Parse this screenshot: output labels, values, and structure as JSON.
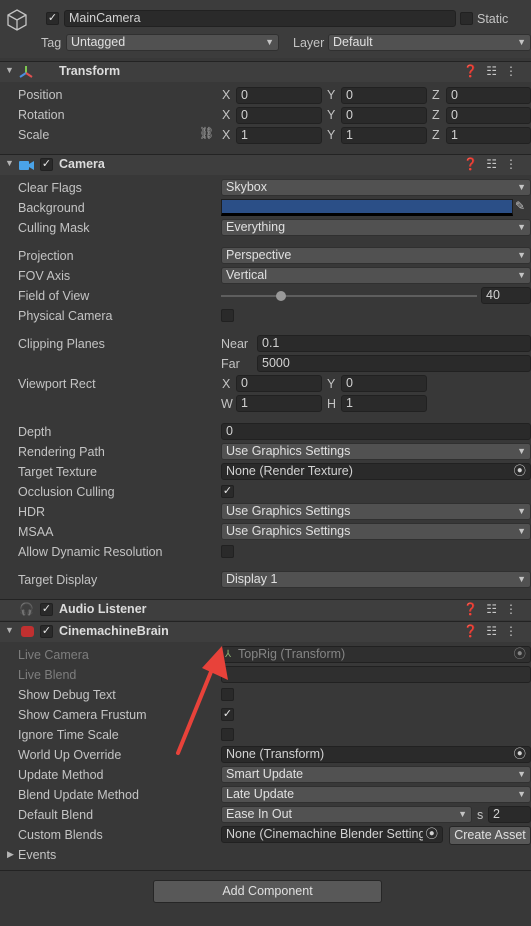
{
  "object": {
    "name": "MainCamera",
    "static_label": "Static",
    "tag_label": "Tag",
    "tag_value": "Untagged",
    "layer_label": "Layer",
    "layer_value": "Default"
  },
  "transform": {
    "title": "Transform",
    "position": {
      "label": "Position",
      "x": "0",
      "y": "0",
      "z": "0"
    },
    "rotation": {
      "label": "Rotation",
      "x": "0",
      "y": "0",
      "z": "0"
    },
    "scale": {
      "label": "Scale",
      "x": "1",
      "y": "1",
      "z": "1"
    },
    "axes": {
      "x": "X",
      "y": "Y",
      "z": "Z"
    }
  },
  "camera": {
    "title": "Camera",
    "clear_flags": {
      "label": "Clear Flags",
      "value": "Skybox"
    },
    "background": {
      "label": "Background",
      "color": "#2b4f87"
    },
    "culling_mask": {
      "label": "Culling Mask",
      "value": "Everything"
    },
    "projection": {
      "label": "Projection",
      "value": "Perspective"
    },
    "fov_axis": {
      "label": "FOV Axis",
      "value": "Vertical"
    },
    "field_of_view": {
      "label": "Field of View",
      "value": "40",
      "slider_fraction": 0.35
    },
    "physical_camera": {
      "label": "Physical Camera"
    },
    "clipping": {
      "label": "Clipping Planes",
      "near_label": "Near",
      "near": "0.1",
      "far_label": "Far",
      "far": "5000"
    },
    "viewport": {
      "label": "Viewport Rect",
      "x_label": "X",
      "x": "0",
      "y_label": "Y",
      "y": "0",
      "w_label": "W",
      "w": "1",
      "h_label": "H",
      "h": "1"
    },
    "depth": {
      "label": "Depth",
      "value": "0"
    },
    "rendering_path": {
      "label": "Rendering Path",
      "value": "Use Graphics Settings"
    },
    "target_texture": {
      "label": "Target Texture",
      "value": "None (Render Texture)"
    },
    "occlusion": {
      "label": "Occlusion Culling",
      "checked": true
    },
    "hdr": {
      "label": "HDR",
      "value": "Use Graphics Settings"
    },
    "msaa": {
      "label": "MSAA",
      "value": "Use Graphics Settings"
    },
    "dynamic_res": {
      "label": "Allow Dynamic Resolution"
    },
    "target_display": {
      "label": "Target Display",
      "value": "Display 1"
    }
  },
  "audio_listener": {
    "title": "Audio Listener"
  },
  "brain": {
    "title": "CinemachineBrain",
    "live_camera": {
      "label": "Live Camera",
      "value": "TopRig (Transform)"
    },
    "live_blend": {
      "label": "Live Blend"
    },
    "debug_text": {
      "label": "Show Debug Text"
    },
    "frustum": {
      "label": "Show Camera Frustum",
      "checked": true
    },
    "ignore_time": {
      "label": "Ignore Time Scale"
    },
    "world_up": {
      "label": "World Up Override",
      "value": "None (Transform)"
    },
    "update_method": {
      "label": "Update Method",
      "value": "Smart Update"
    },
    "blend_update": {
      "label": "Blend Update Method",
      "value": "Late Update"
    },
    "default_blend": {
      "label": "Default Blend",
      "value": "Ease In Out",
      "s_label": "s",
      "seconds": "2"
    },
    "custom_blends": {
      "label": "Custom Blends",
      "value": "None (Cinemachine Blender Setting",
      "button": "Create Asset"
    },
    "events": {
      "label": "Events"
    }
  },
  "add_component": "Add Component",
  "colors": {
    "annotation_arrow": "#e8423a",
    "background_swatch": "#2b4f87"
  },
  "icons": {
    "gameobject": "cube-icon",
    "transform": "transform-axes-icon",
    "camera": "camera-icon",
    "audio": "headphones-icon",
    "brain": "cinemachine-icon",
    "help": "help-icon",
    "presets": "sliders-icon",
    "menu": "kebab-menu-icon",
    "picker": "eyedropper-icon",
    "object_picker": "object-picker-icon",
    "link": "link-icon"
  }
}
